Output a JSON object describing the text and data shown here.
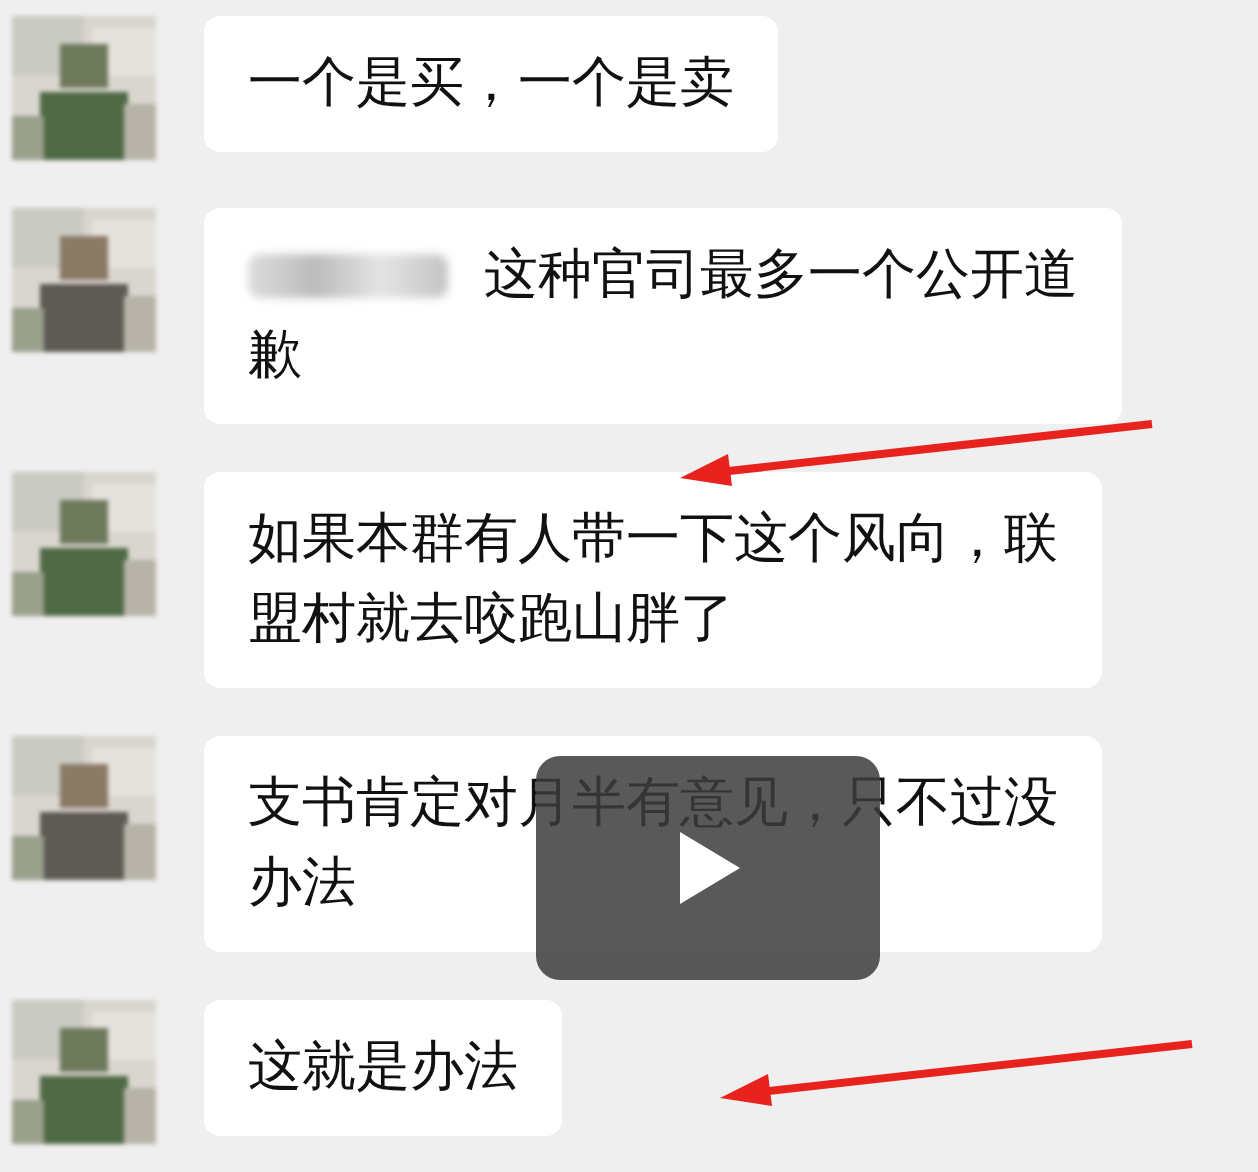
{
  "messages": [
    {
      "redacted_prefix": false,
      "lines": [
        "一个是买，一个是卖"
      ],
      "marked": false
    },
    {
      "redacted_prefix": true,
      "lines": [
        "这种官司最多一个公开道",
        "歉"
      ],
      "marked": false
    },
    {
      "redacted_prefix": false,
      "lines": [
        "如果本群有人带一下这个风向，联",
        "盟村就去咬跑山胖了"
      ],
      "marked": true
    },
    {
      "redacted_prefix": false,
      "lines": [
        "支书肯定对月半有意见，只不过没",
        "办法"
      ],
      "marked": false
    },
    {
      "redacted_prefix": false,
      "lines": [
        "这就是办法"
      ],
      "marked": true
    }
  ],
  "video_overlay": {
    "play_button": true
  }
}
